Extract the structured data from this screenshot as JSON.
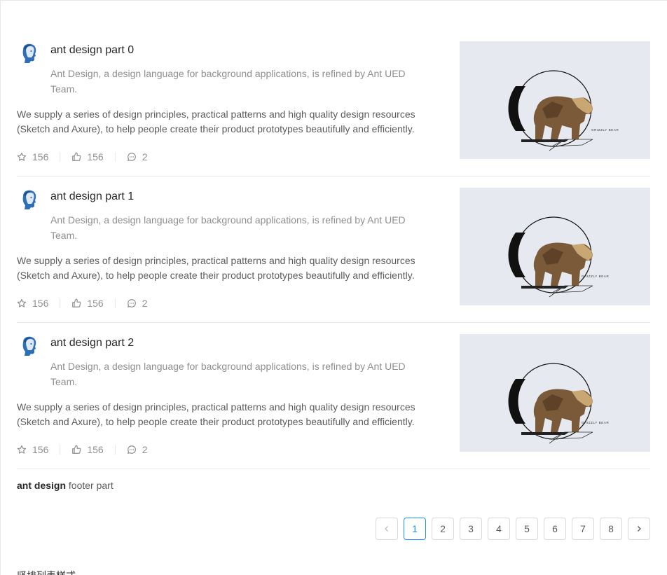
{
  "items": [
    {
      "title": "ant design part 0",
      "description": "Ant Design, a design language for background applications, is refined by Ant UED Team.",
      "content": "We supply a series of design principles, practical patterns and high quality design resources (Sketch and Axure), to help people create their product prototypes beautifully and efficiently.",
      "stars": "156",
      "likes": "156",
      "comments": "2",
      "image_text": "GRIZZLY BEAR"
    },
    {
      "title": "ant design part 1",
      "description": "Ant Design, a design language for background applications, is refined by Ant UED Team.",
      "content": "We supply a series of design principles, practical patterns and high quality design resources (Sketch and Axure), to help people create their product prototypes beautifully and efficiently.",
      "stars": "156",
      "likes": "156",
      "comments": "2",
      "image_text": "GRIZZLY BEAR"
    },
    {
      "title": "ant design part 2",
      "description": "Ant Design, a design language for background applications, is refined by Ant UED Team.",
      "content": "We supply a series of design principles, practical patterns and high quality design resources (Sketch and Axure), to help people create their product prototypes beautifully and efficiently.",
      "stars": "156",
      "likes": "156",
      "comments": "2",
      "image_text": "GRIZZLY BEAR"
    }
  ],
  "footer": {
    "bold": "ant design",
    "text": " footer part"
  },
  "pagination": {
    "pages": [
      "1",
      "2",
      "3",
      "4",
      "5",
      "6",
      "7",
      "8"
    ],
    "current": "1",
    "prev_icon": "chevron-left-icon",
    "next_icon": "chevron-right-icon"
  },
  "bottom_title": "竖排列表样式",
  "colors": {
    "primary": "#1890ff",
    "border": "#e8e8e8",
    "image_bg": "#e6e9ef"
  }
}
